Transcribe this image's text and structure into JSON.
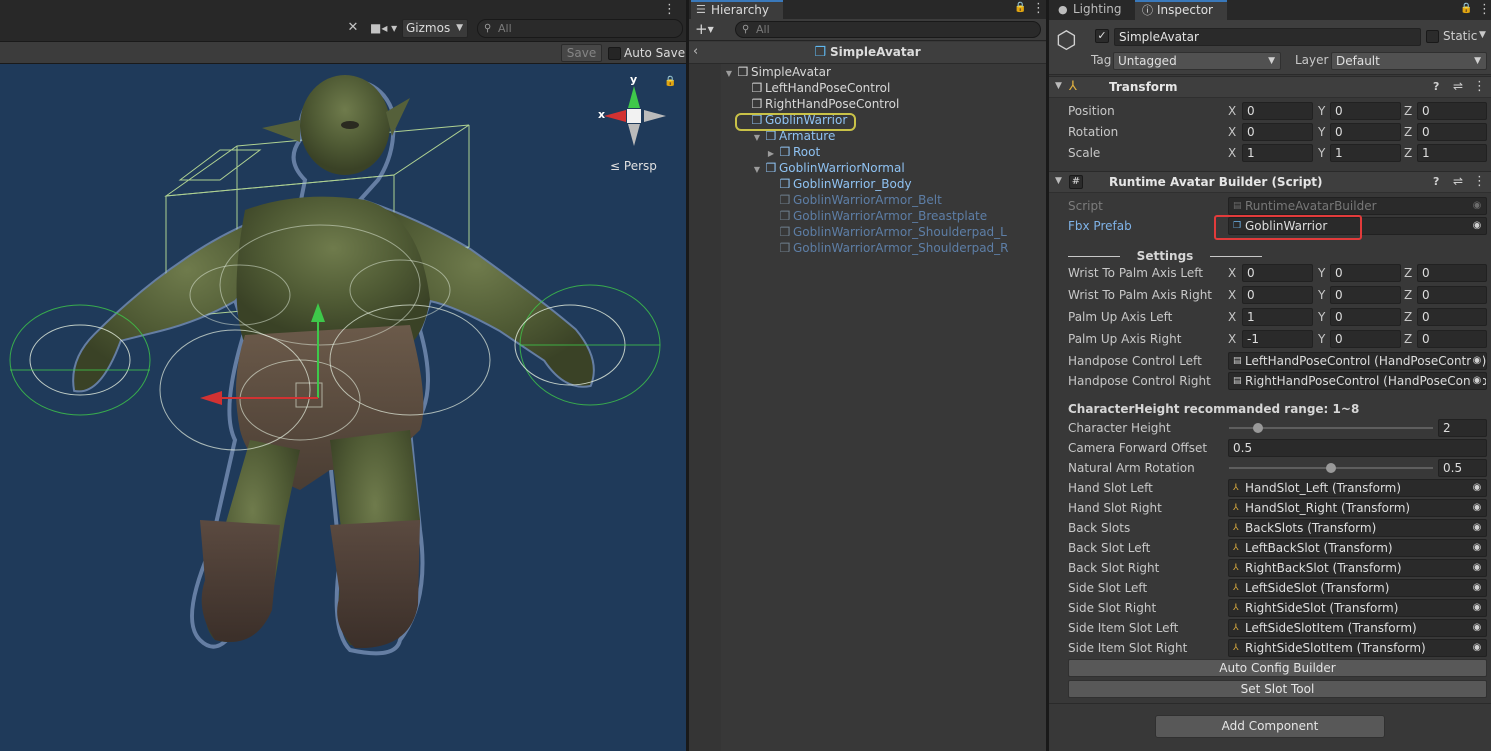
{
  "scene": {
    "gizmos_label": "Gizmos",
    "search_placeholder": "All",
    "save_label": "Save",
    "autosave_label": "Auto Save",
    "persp_label": "Persp",
    "axis_x": "x",
    "axis_y": "y"
  },
  "hierarchy": {
    "tab_label": "Hierarchy",
    "search_placeholder": "All",
    "title": "SimpleAvatar",
    "items": [
      {
        "label": "SimpleAvatar",
        "depth": 0,
        "expanded": true,
        "style": "normal"
      },
      {
        "label": "LeftHandPoseControl",
        "depth": 1,
        "style": "normal"
      },
      {
        "label": "RightHandPoseControl",
        "depth": 1,
        "style": "normal"
      },
      {
        "label": "GoblinWarrior",
        "depth": 1,
        "style": "prefab",
        "selected": true
      },
      {
        "label": "Armature",
        "depth": 2,
        "expanded": true,
        "style": "prefab"
      },
      {
        "label": "Root",
        "depth": 3,
        "collapsed": true,
        "style": "prefab"
      },
      {
        "label": "GoblinWarriorNormal",
        "depth": 2,
        "expanded": true,
        "style": "prefab"
      },
      {
        "label": "GoblinWarrior_Body",
        "depth": 3,
        "style": "prefab"
      },
      {
        "label": "GoblinWarriorArmor_Belt",
        "depth": 3,
        "style": "dim"
      },
      {
        "label": "GoblinWarriorArmor_Breastplate",
        "depth": 3,
        "style": "dim"
      },
      {
        "label": "GoblinWarriorArmor_Shoulderpad_L",
        "depth": 3,
        "style": "dim"
      },
      {
        "label": "GoblinWarriorArmor_Shoulderpad_R",
        "depth": 3,
        "style": "dim"
      }
    ]
  },
  "inspector": {
    "tab_lighting": "Lighting",
    "tab_inspector": "Inspector",
    "object_name": "SimpleAvatar",
    "static_label": "Static",
    "tag_label": "Tag",
    "tag_value": "Untagged",
    "layer_label": "Layer",
    "layer_value": "Default",
    "transform": {
      "title": "Transform",
      "rows": [
        {
          "label": "Position",
          "x": "0",
          "y": "0",
          "z": "0"
        },
        {
          "label": "Rotation",
          "x": "0",
          "y": "0",
          "z": "0"
        },
        {
          "label": "Scale",
          "x": "1",
          "y": "1",
          "z": "1"
        }
      ]
    },
    "script_component": {
      "title": "Runtime Avatar Builder (Script)",
      "script_label": "Script",
      "script_value": "RuntimeAvatarBuilder",
      "fbx_label": "Fbx Prefab",
      "fbx_value": "GoblinWarrior",
      "settings_label": "Settings",
      "vectors": [
        {
          "label": "Wrist To Palm Axis Left",
          "x": "0",
          "y": "0",
          "z": "0"
        },
        {
          "label": "Wrist To Palm Axis Right",
          "x": "0",
          "y": "0",
          "z": "0"
        },
        {
          "label": "Palm Up Axis Left",
          "x": "1",
          "y": "0",
          "z": "0"
        },
        {
          "label": "Palm Up Axis Right",
          "x": "-1",
          "y": "0",
          "z": "0"
        }
      ],
      "handpose_left_label": "Handpose Control Left",
      "handpose_left_value": "LeftHandPoseControl (HandPoseControl)",
      "handpose_right_label": "Handpose Control Right",
      "handpose_right_value": "RightHandPoseControl (HandPoseControl)",
      "range_note": "CharacterHeight recommanded range: 1~8",
      "character_height_label": "Character Height",
      "character_height_value": "2",
      "character_height_slider": {
        "value": 2,
        "min": 1,
        "max": 8
      },
      "camera_offset_label": "Camera Forward Offset",
      "camera_offset_value": "0.5",
      "arm_rotation_label": "Natural Arm Rotation",
      "arm_rotation_value": "0.5",
      "arm_rotation_slider": {
        "value": 0.5,
        "min": 0,
        "max": 1
      },
      "slots": [
        {
          "label": "Hand Slot Left",
          "value": "HandSlot_Left (Transform)"
        },
        {
          "label": "Hand Slot Right",
          "value": "HandSlot_Right (Transform)"
        },
        {
          "label": "Back Slots",
          "value": "BackSlots (Transform)"
        },
        {
          "label": "Back Slot Left",
          "value": "LeftBackSlot (Transform)"
        },
        {
          "label": "Back Slot Right",
          "value": "RightBackSlot (Transform)"
        },
        {
          "label": "Side Slot Left",
          "value": "LeftSideSlot (Transform)"
        },
        {
          "label": "Side Slot Right",
          "value": "RightSideSlot (Transform)"
        },
        {
          "label": "Side Item Slot Left",
          "value": "LeftSideSlotItem (Transform)"
        },
        {
          "label": "Side Item Slot Right",
          "value": "RightSideSlotItem (Transform)"
        }
      ],
      "auto_config_label": "Auto Config Builder",
      "set_slot_label": "Set Slot Tool"
    },
    "add_component_label": "Add Component"
  },
  "colors": {
    "scene_bg": "#1f3a5a",
    "panel_bg": "#383838",
    "prefab_text": "#8fc2f2",
    "selection_outline": "#c9c248",
    "highlight_red": "#e23b3b",
    "gizmo_green": "#3ec84a",
    "gizmo_red": "#d23232"
  }
}
